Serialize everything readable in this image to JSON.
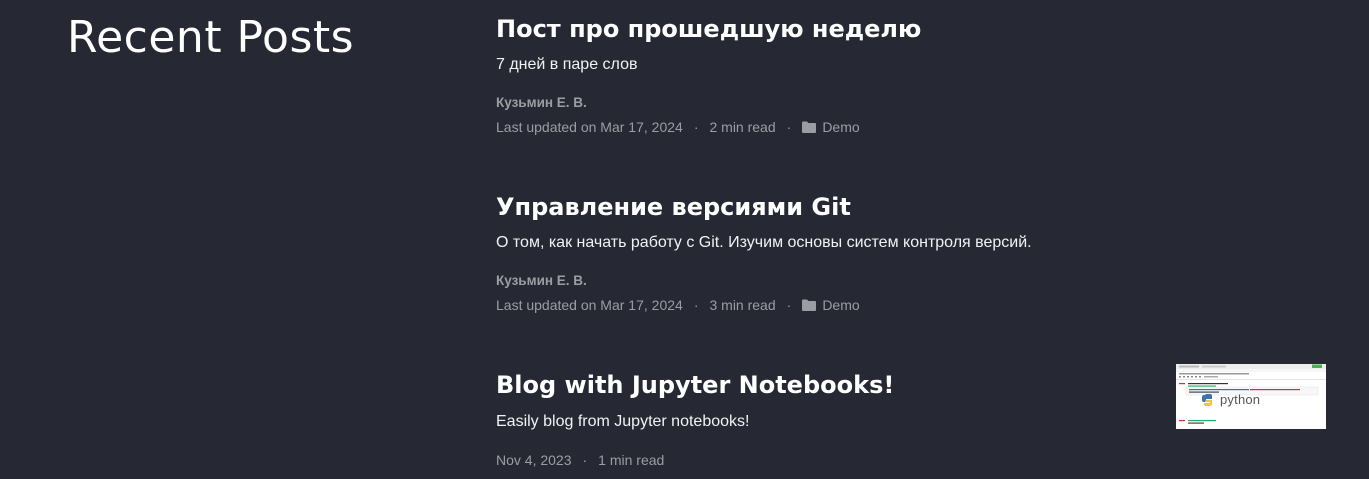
{
  "section": {
    "title": "Recent Posts"
  },
  "posts": [
    {
      "title": "Пост про прошедшую неделю",
      "description": "7 дней в паре слов",
      "author": "Кузьмин Е. В.",
      "date": "Last updated on Mar 17, 2024",
      "read_time": "2 min read",
      "category": "Demo",
      "category_icon": "folder-icon"
    },
    {
      "title": "Управление версиями Git",
      "description": "О том, как начать работу с Git. Изучим основы систем контроля версий.",
      "author": "Кузьмин Е. В.",
      "date": "Last updated on Mar 17, 2024",
      "read_time": "3 min read",
      "category": "Demo",
      "category_icon": "folder-icon"
    },
    {
      "title": "Blog with Jupyter Notebooks!",
      "description": "Easily blog from Jupyter notebooks!",
      "date": "Nov 4, 2023",
      "read_time": "1 min read",
      "thumbnail_text": "python"
    }
  ],
  "separator": "·",
  "colors": {
    "background": "#262834",
    "title": "#ffffff",
    "text": "#f2f2f2",
    "meta": "#9c9da2"
  }
}
